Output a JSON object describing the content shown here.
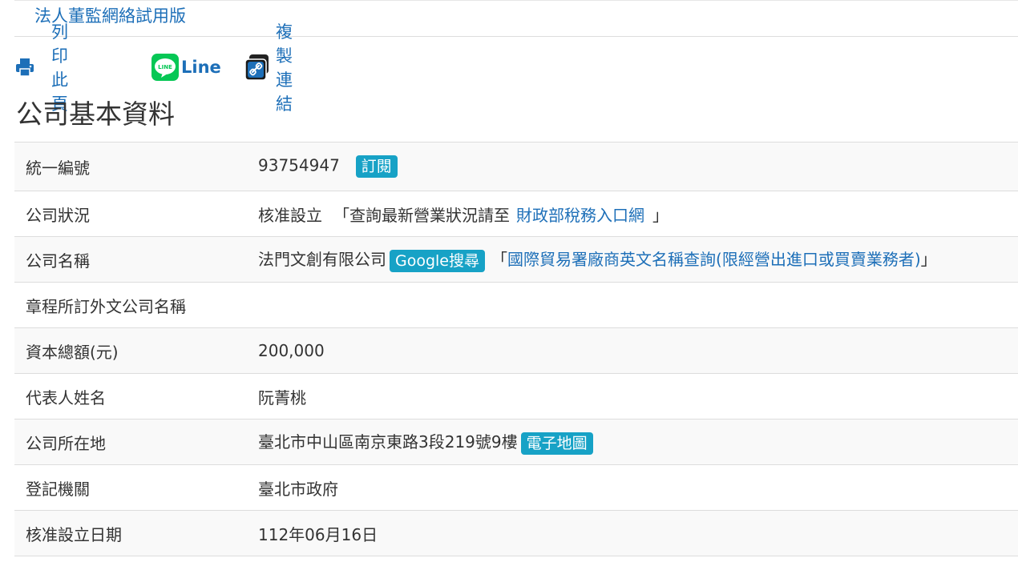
{
  "top_link": "法人董監網絡試用版",
  "share": {
    "print_label": "列印此頁",
    "line_label": "Line",
    "line_icon_text": "LINE",
    "copy_label": "複製連結"
  },
  "page_title": "公司基本資料",
  "rows": [
    {
      "label": "統一編號",
      "value": "93754947",
      "badge": "訂閱"
    },
    {
      "label": "公司狀況",
      "value": "核准設立",
      "note_open": "「查詢最新營業狀況請至",
      "link": "財政部稅務入口網",
      "note_close": "」"
    },
    {
      "label": "公司名稱",
      "value": "法門文創有限公司",
      "badge": "Google搜尋",
      "note_open": "「",
      "link": "國際貿易署廠商英文名稱查詢(限經營出進口或買賣業務者)",
      "note_close": "」"
    },
    {
      "label": "章程所訂外文公司名稱",
      "value": ""
    },
    {
      "label": "資本總額(元)",
      "value": "200,000"
    },
    {
      "label": "代表人姓名",
      "value": "阮菁桃"
    },
    {
      "label": "公司所在地",
      "value": "臺北市中山區南京東路3段219號9樓",
      "badge": "電子地圖"
    },
    {
      "label": "登記機關",
      "value": "臺北市政府"
    },
    {
      "label": "核准設立日期",
      "value": "112年06月16日"
    }
  ],
  "colors": {
    "link": "#1d6fb8",
    "badge_bg": "#17a2c6",
    "line_green": "#06c755",
    "stripe": "#f9f9f9",
    "border": "#dddddd"
  }
}
